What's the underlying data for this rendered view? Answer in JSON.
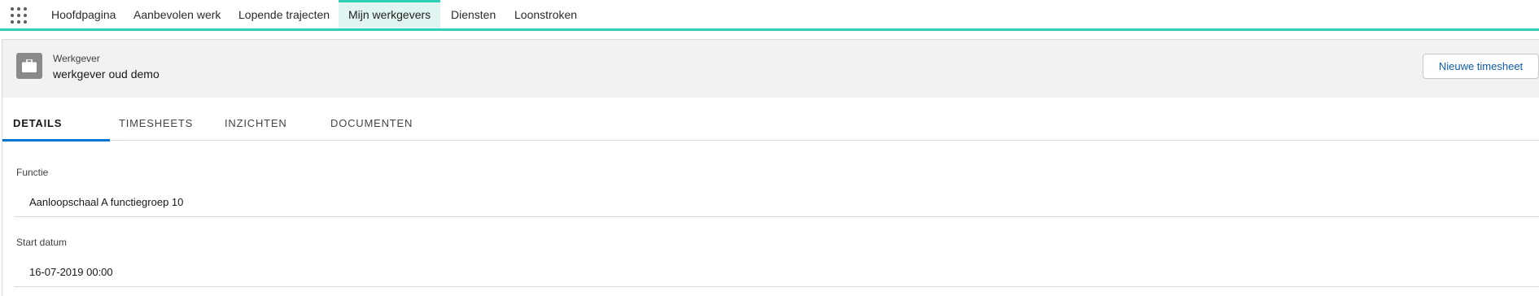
{
  "nav": {
    "items": [
      {
        "label": "Hoofdpagina"
      },
      {
        "label": "Aanbevolen werk"
      },
      {
        "label": "Lopende trajecten"
      },
      {
        "label": "Mijn werkgevers"
      },
      {
        "label": "Diensten"
      },
      {
        "label": "Loonstroken"
      }
    ],
    "active": "Mijn werkgevers",
    "accent": "#2ecfb7"
  },
  "header": {
    "label": "Werkgever",
    "name": "werkgever oud demo",
    "icon": "briefcase-icon",
    "new_timesheet_label": "Nieuwe timesheet"
  },
  "tabs": [
    {
      "label": "DETAILS"
    },
    {
      "label": "TIMESHEETS"
    },
    {
      "label": "INZICHTEN"
    },
    {
      "label": "DOCUMENTEN"
    }
  ],
  "active_tab": "DETAILS",
  "details": {
    "fields": [
      {
        "label": "Functie",
        "value": "Aanloopschaal A functiegroep 10"
      },
      {
        "label": "Start datum",
        "value": "16-07-2019 00:00"
      }
    ]
  }
}
